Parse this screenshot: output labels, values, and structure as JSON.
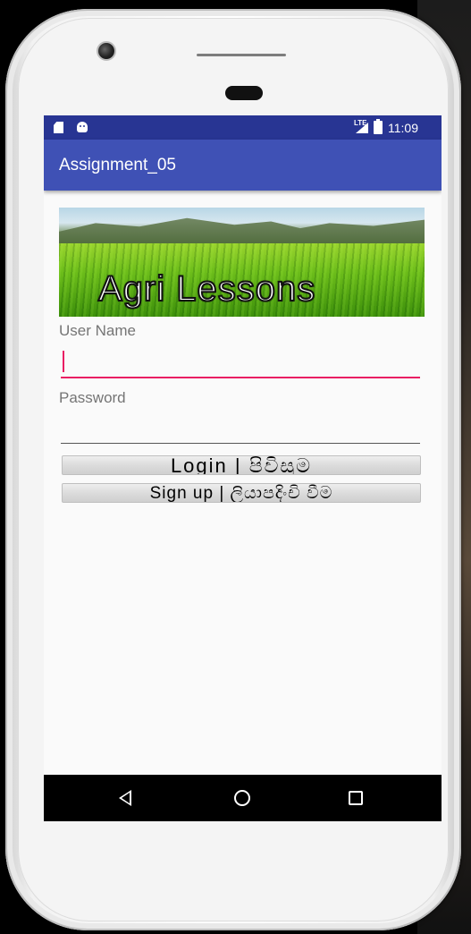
{
  "status_bar": {
    "time": "11:09",
    "network_label": "LTE",
    "icons": [
      "sd-card-icon",
      "android-debug-icon",
      "signal-icon",
      "battery-icon"
    ]
  },
  "app_bar": {
    "title": "Assignment_05",
    "color": "#3f51b5",
    "status_color": "#283593"
  },
  "banner": {
    "text": "Agri Lessons"
  },
  "form": {
    "username_label": "User Name",
    "username_value": "",
    "password_label": "Password",
    "password_value": "",
    "focus_color": "#e91e63"
  },
  "buttons": {
    "login_label": "Login | පිවිසුම",
    "signup_label": "Sign up | ලියාපදිංචි වීම"
  },
  "nav_bar": {
    "icons": [
      "back-icon",
      "home-icon",
      "recents-icon"
    ]
  }
}
